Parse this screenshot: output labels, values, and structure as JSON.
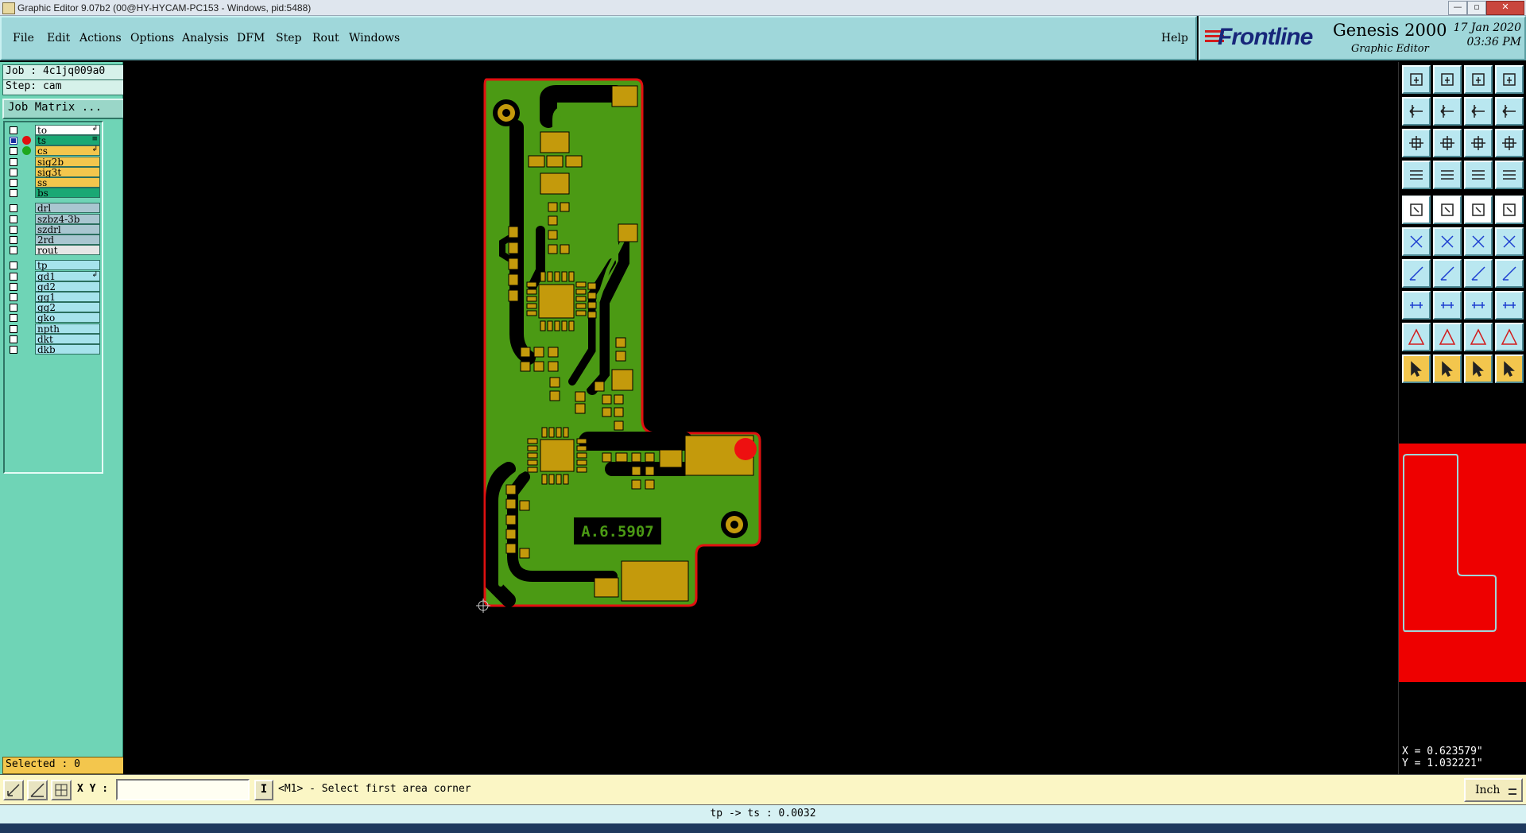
{
  "window": {
    "title": "Graphic Editor 9.07b2 (00@HY-HYCAM-PC153 - Windows, pid:5488)",
    "min_glyph": "—",
    "max_glyph": "▫",
    "close_glyph": "✕"
  },
  "menu": {
    "file": "File",
    "edit": "Edit",
    "actions": "Actions",
    "options": "Options",
    "analysis": "Analysis",
    "dfm": "DFM",
    "step": "Step",
    "rout": "Rout",
    "windows": "Windows",
    "help": "Help"
  },
  "brand": {
    "logo": "Frontline",
    "product": "Genesis 2000",
    "subtitle": "Graphic Editor",
    "date": "17 Jan 2020",
    "time": "03:36 PM"
  },
  "left": {
    "job": "Job : 4c1jq009a0",
    "step": "Step: cam",
    "job_matrix": "Job Matrix ...",
    "selected": "Selected : 0"
  },
  "layers": [
    {
      "name": "to",
      "color": "#ffffff",
      "checked": false,
      "dot": "",
      "mark": "↲"
    },
    {
      "name": "ts",
      "color": "#1aa874",
      "checked": true,
      "dot": "#e01010",
      "mark": "≡"
    },
    {
      "name": "cs",
      "color": "#f3c64d",
      "checked": false,
      "dot": "#1ea81e",
      "mark": "↲"
    },
    {
      "name": "sig2b",
      "color": "#f3c64d",
      "checked": false,
      "dot": "",
      "mark": ""
    },
    {
      "name": "sig3t",
      "color": "#f3c64d",
      "checked": false,
      "dot": "",
      "mark": ""
    },
    {
      "name": "ss",
      "color": "#f3c64d",
      "checked": false,
      "dot": "",
      "mark": ""
    },
    {
      "name": "bs",
      "color": "#1aa874",
      "checked": false,
      "dot": "",
      "mark": ""
    },
    {
      "name": "drl",
      "color": "#a9c6d0",
      "checked": false,
      "dot": "",
      "mark": ""
    },
    {
      "name": "szbz4-3b",
      "color": "#a9c6d0",
      "checked": false,
      "dot": "",
      "mark": ""
    },
    {
      "name": "szdrl",
      "color": "#a9c6d0",
      "checked": false,
      "dot": "",
      "mark": ""
    },
    {
      "name": "2rd",
      "color": "#a9c6d0",
      "checked": false,
      "dot": "",
      "mark": ""
    },
    {
      "name": "rout",
      "color": "#e6e6e6",
      "checked": false,
      "dot": "",
      "mark": ""
    },
    {
      "name": "tp",
      "color": "#a6e3ec",
      "checked": false,
      "dot": "",
      "mark": ""
    },
    {
      "name": "gd1",
      "color": "#a6e3ec",
      "checked": false,
      "dot": "",
      "mark": "↲"
    },
    {
      "name": "gd2",
      "color": "#a6e3ec",
      "checked": false,
      "dot": "",
      "mark": ""
    },
    {
      "name": "gg1",
      "color": "#a6e3ec",
      "checked": false,
      "dot": "",
      "mark": ""
    },
    {
      "name": "gg2",
      "color": "#a6e3ec",
      "checked": false,
      "dot": "",
      "mark": ""
    },
    {
      "name": "gko",
      "color": "#a6e3ec",
      "checked": false,
      "dot": "",
      "mark": ""
    },
    {
      "name": "npth",
      "color": "#a6e3ec",
      "checked": false,
      "dot": "",
      "mark": ""
    },
    {
      "name": "dkt",
      "color": "#a6e3ec",
      "checked": false,
      "dot": "",
      "mark": ""
    },
    {
      "name": "dkb",
      "color": "#a6e3ec",
      "checked": false,
      "dot": "",
      "mark": ""
    }
  ],
  "board": {
    "silk_label": "A.6.5907",
    "outline_color": "#e01010",
    "copper_color": "#4b9a14",
    "pad_color": "#c49a0c"
  },
  "coords": {
    "x": "X = 0.623579\"",
    "y": "Y = 1.032221\""
  },
  "bottom": {
    "xy_label": "X Y :",
    "xy_value": "",
    "ibtn": "I",
    "prompt": "<M1> - Select first area corner",
    "unit": "Inch"
  },
  "status": "tp -> ts : 0.0032",
  "toolbar_icons": [
    "snapshot-icon",
    "fetch-icon",
    "home-icon",
    "layout-icon",
    "pan-left-icon",
    "pan-right-icon",
    "redraw-icon",
    "scroll-icon",
    "zoom-fit-icon",
    "zoom-step-icon",
    "scale-1-2-icon",
    "help-query-icon",
    "hand-icon",
    "grid-icon",
    "layers-a-icon",
    "layers-b-icon",
    "camera-icon",
    "features-icon",
    "ruler-icon",
    "pad-icon",
    "connect-nodes-icon",
    "cross-node-icon",
    "line-node-icon",
    "arc-node-icon",
    "line-draw-icon",
    "slash-icon",
    "rotate-icon",
    "mirror-icon",
    "pad-select-icon",
    "minus-icon",
    "resize-icon",
    "array-icon",
    "triangle-a-icon",
    "triangle-b-icon",
    "triangle-c-icon",
    "triangle-d-icon",
    "pointer-icon",
    "pointer-select-icon",
    "pointer-move-icon",
    "pointer-multi-icon"
  ]
}
